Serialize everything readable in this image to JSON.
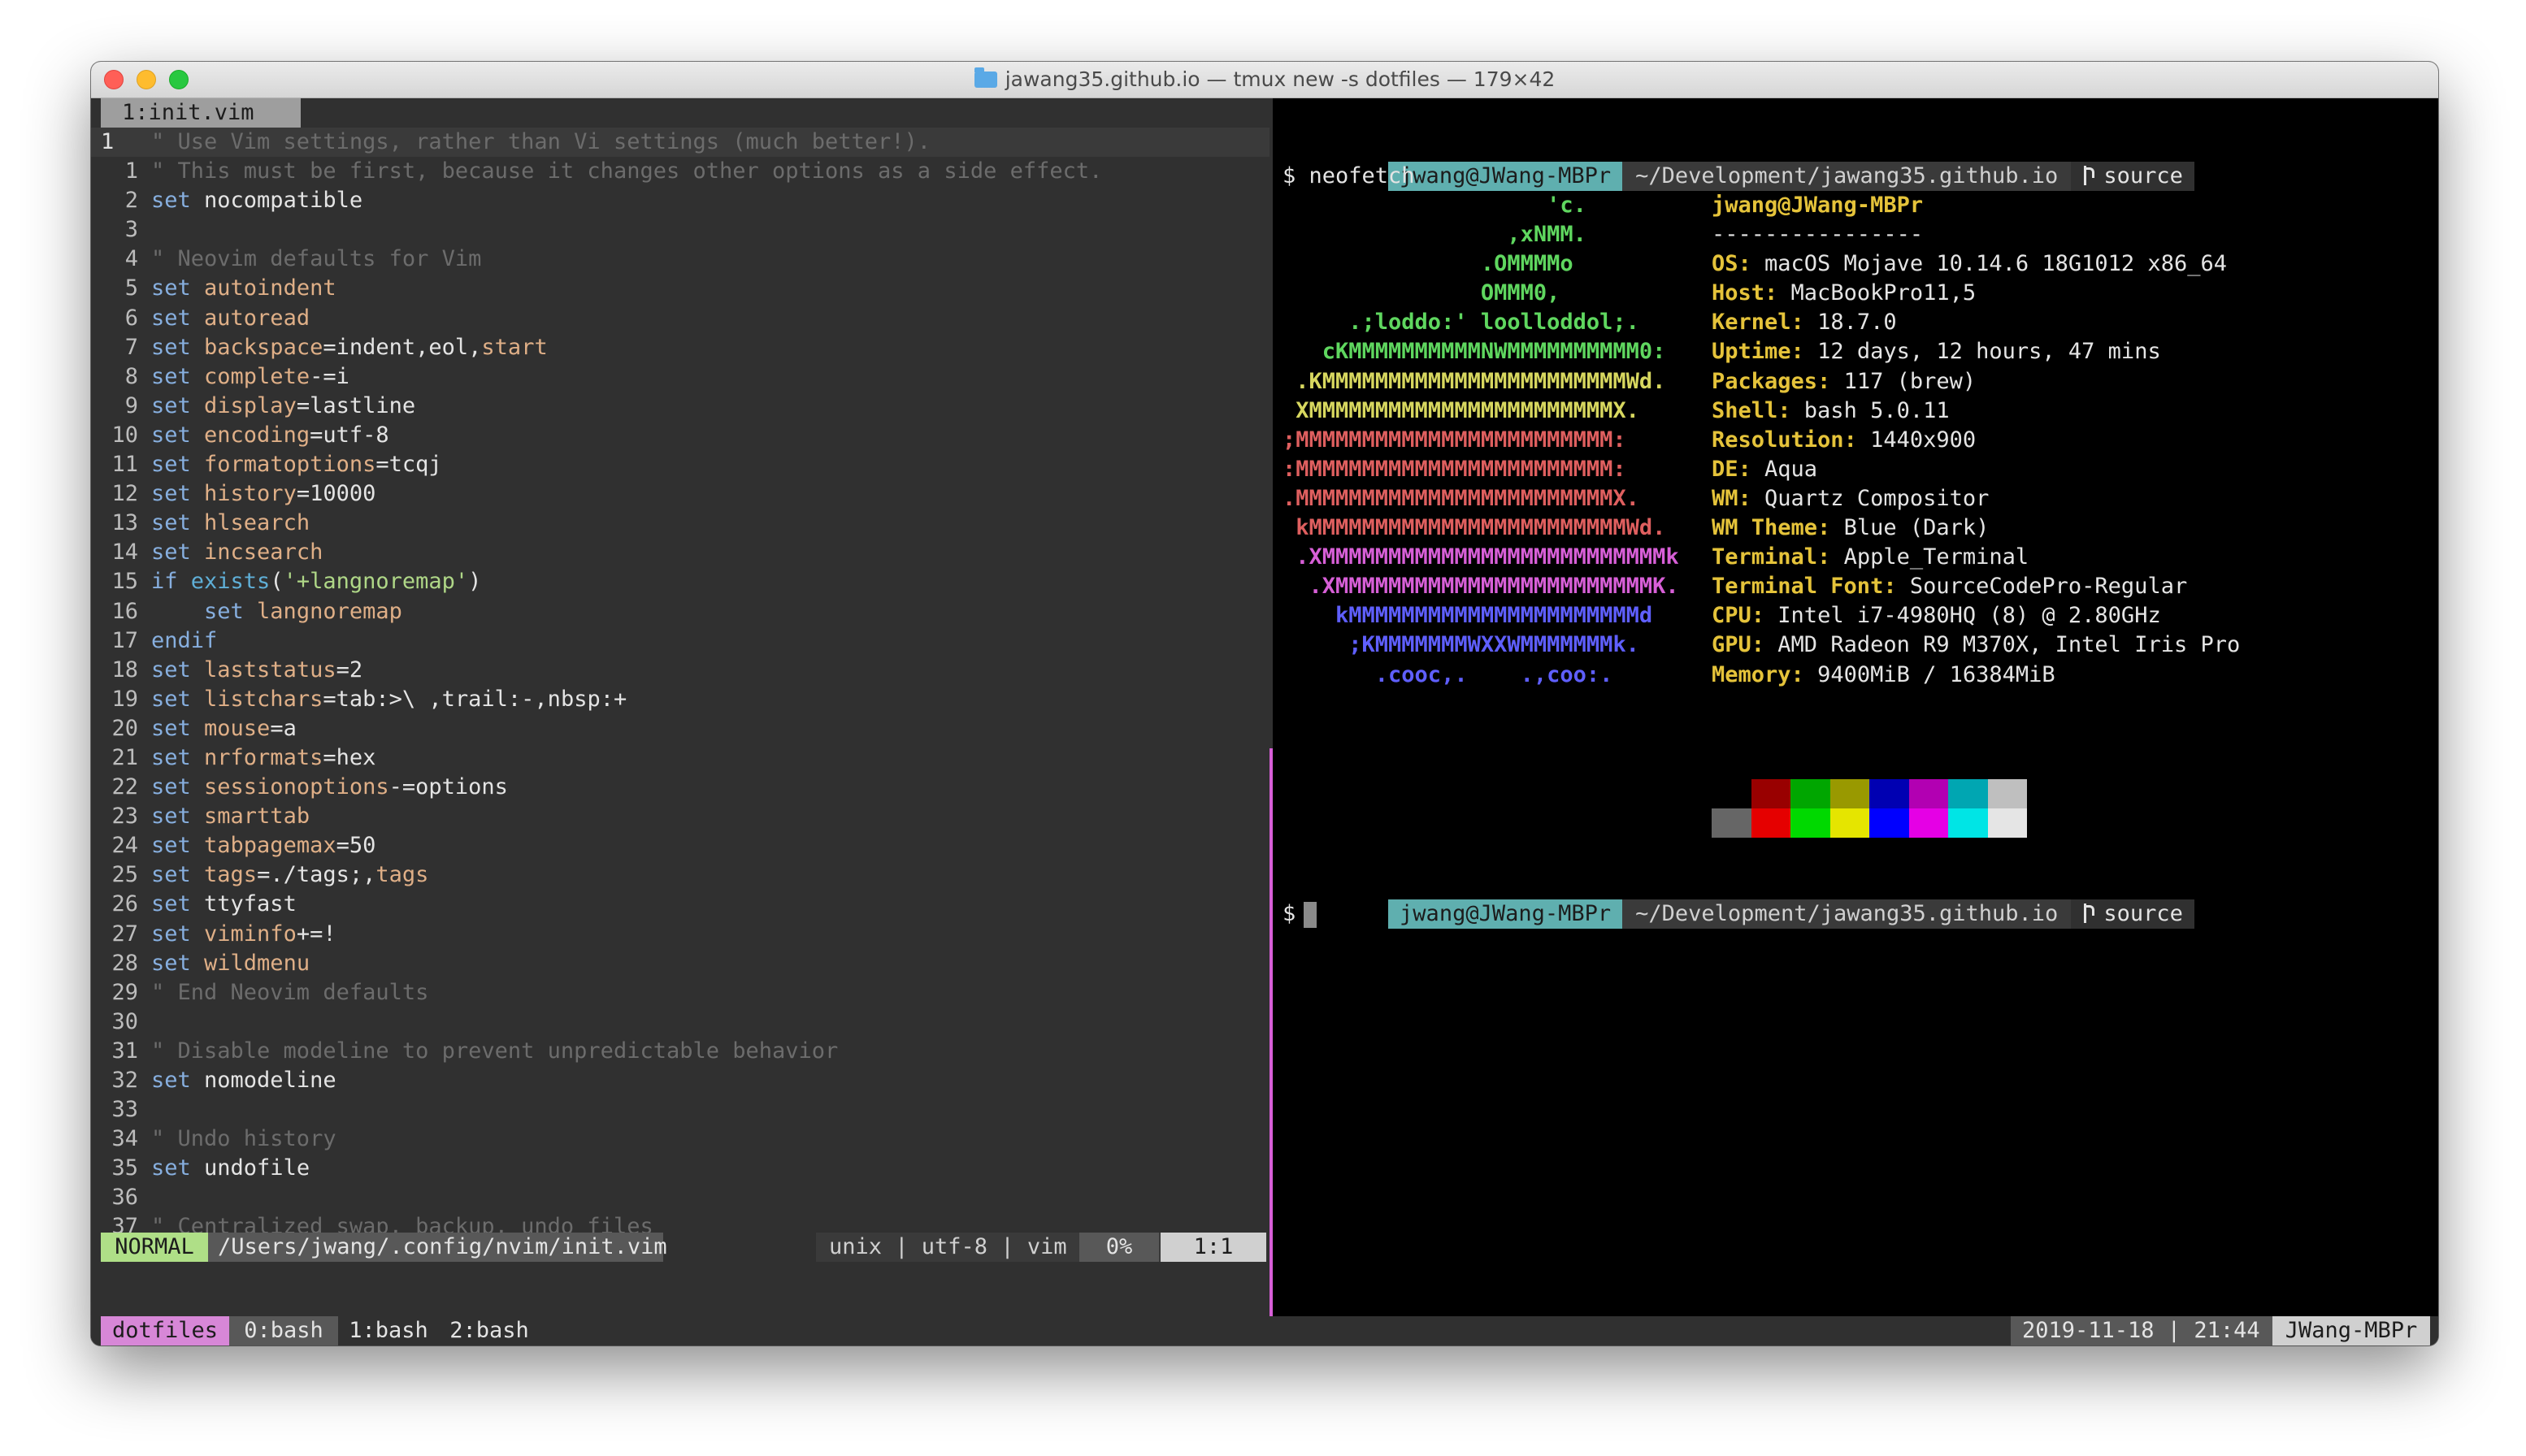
{
  "window": {
    "title": "jawang35.github.io — tmux new -s dotfiles — 179×42",
    "folder_icon": "folder-icon"
  },
  "vim": {
    "tab_label": "1:init.vim",
    "lines": [
      {
        "num": "1",
        "current": true,
        "segs": [
          {
            "t": "\" Use Vim settings, rather than Vi settings (much better!).",
            "c": "com"
          }
        ]
      },
      {
        "num": "1",
        "segs": [
          {
            "t": "\" This must be first, because it changes other options as a side effect.",
            "c": "com"
          }
        ]
      },
      {
        "num": "2",
        "segs": [
          {
            "t": "set ",
            "c": "kw"
          },
          {
            "t": "nocompatible",
            "c": ""
          }
        ]
      },
      {
        "num": "3",
        "segs": []
      },
      {
        "num": "4",
        "segs": [
          {
            "t": "\" Neovim defaults for Vim",
            "c": "com"
          }
        ]
      },
      {
        "num": "5",
        "segs": [
          {
            "t": "set ",
            "c": "kw"
          },
          {
            "t": "autoindent",
            "c": "opt"
          }
        ]
      },
      {
        "num": "6",
        "segs": [
          {
            "t": "set ",
            "c": "kw"
          },
          {
            "t": "autoread",
            "c": "opt"
          }
        ]
      },
      {
        "num": "7",
        "segs": [
          {
            "t": "set ",
            "c": "kw"
          },
          {
            "t": "backspace",
            "c": "opt"
          },
          {
            "t": "=indent,eol,",
            "c": ""
          },
          {
            "t": "start",
            "c": "opt"
          }
        ]
      },
      {
        "num": "8",
        "segs": [
          {
            "t": "set ",
            "c": "kw"
          },
          {
            "t": "complete",
            "c": "opt"
          },
          {
            "t": "-=i",
            "c": ""
          }
        ]
      },
      {
        "num": "9",
        "segs": [
          {
            "t": "set ",
            "c": "kw"
          },
          {
            "t": "display",
            "c": "opt"
          },
          {
            "t": "=lastline",
            "c": ""
          }
        ]
      },
      {
        "num": "10",
        "segs": [
          {
            "t": "set ",
            "c": "kw"
          },
          {
            "t": "encoding",
            "c": "opt"
          },
          {
            "t": "=utf-8",
            "c": ""
          }
        ]
      },
      {
        "num": "11",
        "segs": [
          {
            "t": "set ",
            "c": "kw"
          },
          {
            "t": "formatoptions",
            "c": "opt"
          },
          {
            "t": "=tcqj",
            "c": ""
          }
        ]
      },
      {
        "num": "12",
        "segs": [
          {
            "t": "set ",
            "c": "kw"
          },
          {
            "t": "history",
            "c": "opt"
          },
          {
            "t": "=10000",
            "c": ""
          }
        ]
      },
      {
        "num": "13",
        "segs": [
          {
            "t": "set ",
            "c": "kw"
          },
          {
            "t": "hlsearch",
            "c": "opt"
          }
        ]
      },
      {
        "num": "14",
        "segs": [
          {
            "t": "set ",
            "c": "kw"
          },
          {
            "t": "incsearch",
            "c": "opt"
          }
        ]
      },
      {
        "num": "15",
        "segs": [
          {
            "t": "if ",
            "c": "kw"
          },
          {
            "t": "exists",
            "c": "fn"
          },
          {
            "t": "(",
            "c": ""
          },
          {
            "t": "'+langnoremap'",
            "c": "str"
          },
          {
            "t": ")",
            "c": ""
          }
        ]
      },
      {
        "num": "16",
        "segs": [
          {
            "t": "    set ",
            "c": "kw"
          },
          {
            "t": "langnoremap",
            "c": "opt"
          }
        ]
      },
      {
        "num": "17",
        "segs": [
          {
            "t": "endif",
            "c": "kw"
          }
        ]
      },
      {
        "num": "18",
        "segs": [
          {
            "t": "set ",
            "c": "kw"
          },
          {
            "t": "laststatus",
            "c": "opt"
          },
          {
            "t": "=2",
            "c": ""
          }
        ]
      },
      {
        "num": "19",
        "segs": [
          {
            "t": "set ",
            "c": "kw"
          },
          {
            "t": "listchars",
            "c": "opt"
          },
          {
            "t": "=tab:>\\ ,trail:-,nbsp:+",
            "c": ""
          }
        ]
      },
      {
        "num": "20",
        "segs": [
          {
            "t": "set ",
            "c": "kw"
          },
          {
            "t": "mouse",
            "c": "opt"
          },
          {
            "t": "=a",
            "c": ""
          }
        ]
      },
      {
        "num": "21",
        "segs": [
          {
            "t": "set ",
            "c": "kw"
          },
          {
            "t": "nrformats",
            "c": "opt"
          },
          {
            "t": "=hex",
            "c": ""
          }
        ]
      },
      {
        "num": "22",
        "segs": [
          {
            "t": "set ",
            "c": "kw"
          },
          {
            "t": "sessionoptions",
            "c": "opt"
          },
          {
            "t": "-=options",
            "c": ""
          }
        ]
      },
      {
        "num": "23",
        "segs": [
          {
            "t": "set ",
            "c": "kw"
          },
          {
            "t": "smarttab",
            "c": "opt"
          }
        ]
      },
      {
        "num": "24",
        "segs": [
          {
            "t": "set ",
            "c": "kw"
          },
          {
            "t": "tabpagemax",
            "c": "opt"
          },
          {
            "t": "=50",
            "c": ""
          }
        ]
      },
      {
        "num": "25",
        "segs": [
          {
            "t": "set ",
            "c": "kw"
          },
          {
            "t": "tags",
            "c": "opt"
          },
          {
            "t": "=./tags;,",
            "c": ""
          },
          {
            "t": "tags",
            "c": "opt"
          }
        ]
      },
      {
        "num": "26",
        "segs": [
          {
            "t": "set ",
            "c": "kw"
          },
          {
            "t": "ttyfast",
            "c": ""
          }
        ]
      },
      {
        "num": "27",
        "segs": [
          {
            "t": "set ",
            "c": "kw"
          },
          {
            "t": "viminfo",
            "c": "opt"
          },
          {
            "t": "+=!",
            "c": ""
          }
        ]
      },
      {
        "num": "28",
        "segs": [
          {
            "t": "set ",
            "c": "kw"
          },
          {
            "t": "wildmenu",
            "c": "opt"
          }
        ]
      },
      {
        "num": "29",
        "segs": [
          {
            "t": "\" End Neovim defaults",
            "c": "com"
          }
        ]
      },
      {
        "num": "30",
        "segs": []
      },
      {
        "num": "31",
        "segs": [
          {
            "t": "\" Disable modeline to prevent unpredictable behavior",
            "c": "com"
          }
        ]
      },
      {
        "num": "32",
        "segs": [
          {
            "t": "set ",
            "c": "kw"
          },
          {
            "t": "nomodeline",
            "c": ""
          }
        ]
      },
      {
        "num": "33",
        "segs": []
      },
      {
        "num": "34",
        "segs": [
          {
            "t": "\" Undo history",
            "c": "com"
          }
        ]
      },
      {
        "num": "35",
        "segs": [
          {
            "t": "set ",
            "c": "kw"
          },
          {
            "t": "undofile",
            "c": ""
          }
        ]
      },
      {
        "num": "36",
        "segs": []
      },
      {
        "num": "37",
        "segs": [
          {
            "t": "\" Centralized swap, backup, undo files",
            "c": "com"
          }
        ]
      }
    ],
    "status": {
      "mode": "NORMAL",
      "file": "/Users/jwang/.config/nvim/init.vim",
      "info": "unix | utf-8 | vim",
      "percent": "0%",
      "position": "1:1"
    }
  },
  "terminal": {
    "prompt": {
      "user": "jwang@JWang-MBPr",
      "path": "~/Development/jawang35.github.io",
      "branch": "source",
      "branch_icon": "git-branch-icon"
    },
    "command": "$ neofetch",
    "prompt_symbol": "$",
    "logo": [
      {
        "t": "                    'c.",
        "color": "#5fd75f"
      },
      {
        "t": "                 ,xNMM.",
        "color": "#5fd75f"
      },
      {
        "t": "               .OMMMMo",
        "color": "#5fd75f"
      },
      {
        "t": "               OMMM0,",
        "color": "#5fd75f"
      },
      {
        "t": "     .;loddo:' loolloddol;.",
        "color": "#5fd75f"
      },
      {
        "t": "   cKMMMMMMMMMMNWMMMMMMMMMM0:",
        "color": "#5fd75f"
      },
      {
        "t": " .KMMMMMMMMMMMMMMMMMMMMMMMWd.",
        "color": "#d7d75f"
      },
      {
        "t": " XMMMMMMMMMMMMMMMMMMMMMMMX.",
        "color": "#d7d75f"
      },
      {
        "t": ";MMMMMMMMMMMMMMMMMMMMMMMM:",
        "color": "#df5f5f"
      },
      {
        "t": ":MMMMMMMMMMMMMMMMMMMMMMMM:",
        "color": "#df5f5f"
      },
      {
        "t": ".MMMMMMMMMMMMMMMMMMMMMMMMX.",
        "color": "#df5f5f"
      },
      {
        "t": " kMMMMMMMMMMMMMMMMMMMMMMMMWd.",
        "color": "#df5f5f"
      },
      {
        "t": " .XMMMMMMMMMMMMMMMMMMMMMMMMMMk",
        "color": "#d75fd7"
      },
      {
        "t": "  .XMMMMMMMMMMMMMMMMMMMMMMMMK.",
        "color": "#d75fd7"
      },
      {
        "t": "    kMMMMMMMMMMMMMMMMMMMMMMd",
        "color": "#5f5fff"
      },
      {
        "t": "     ;KMMMMMMMWXXWMMMMMMMk.",
        "color": "#5f5fff"
      },
      {
        "t": "       .cooc,.    .,coo:.",
        "color": "#5f5fff"
      }
    ],
    "info": {
      "user": "jwang@JWang-MBPr",
      "separator": "----------------",
      "rows": [
        {
          "key": "OS",
          "value": "macOS Mojave 10.14.6 18G1012 x86_64"
        },
        {
          "key": "Host",
          "value": "MacBookPro11,5"
        },
        {
          "key": "Kernel",
          "value": "18.7.0"
        },
        {
          "key": "Uptime",
          "value": "12 days, 12 hours, 47 mins"
        },
        {
          "key": "Packages",
          "value": "117 (brew)"
        },
        {
          "key": "Shell",
          "value": "bash 5.0.11"
        },
        {
          "key": "Resolution",
          "value": "1440x900"
        },
        {
          "key": "DE",
          "value": "Aqua"
        },
        {
          "key": "WM",
          "value": "Quartz Compositor"
        },
        {
          "key": "WM Theme",
          "value": "Blue (Dark)"
        },
        {
          "key": "Terminal",
          "value": "Apple_Terminal"
        },
        {
          "key": "Terminal Font",
          "value": "SourceCodePro-Regular"
        },
        {
          "key": "CPU",
          "value": "Intel i7-4980HQ (8) @ 2.80GHz"
        },
        {
          "key": "GPU",
          "value": "AMD Radeon R9 M370X, Intel Iris Pro"
        },
        {
          "key": "Memory",
          "value": "9400MiB / 16384MiB"
        }
      ]
    },
    "palette_top": [
      "#000000",
      "#990000",
      "#00a600",
      "#999900",
      "#0000b2",
      "#b200b2",
      "#00a6b2",
      "#bfbfbf"
    ],
    "palette_bottom": [
      "#666666",
      "#e50000",
      "#00d900",
      "#e5e500",
      "#0000ff",
      "#e500e5",
      "#00e5e5",
      "#e5e5e5"
    ]
  },
  "tmux": {
    "session": "dotfiles",
    "windows": [
      "0:bash",
      "1:bash",
      "2:bash"
    ],
    "date_time": "2019-11-18 | 21:44",
    "host": "JWang-MBPr"
  }
}
